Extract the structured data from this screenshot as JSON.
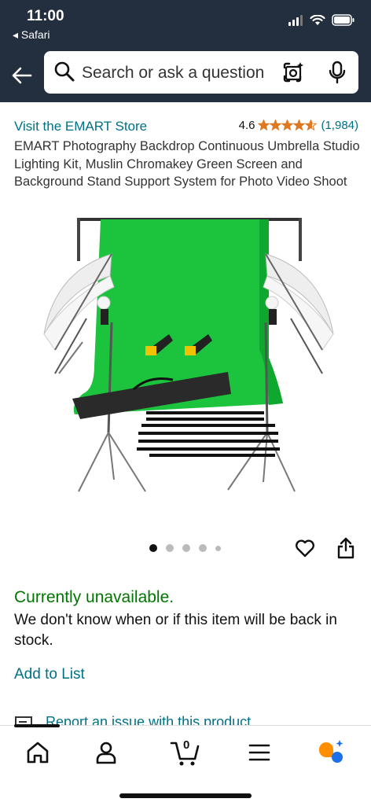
{
  "status_bar": {
    "time": "11:00",
    "back_app": "◂ Safari"
  },
  "search": {
    "placeholder": "Search or ask a question"
  },
  "product": {
    "store_link": "Visit the EMART Store",
    "rating": "4.6",
    "stars": 4.6,
    "review_count": "(1,984)",
    "title": "EMART Photography Backdrop Continuous Umbrella Studio Lighting Kit, Muslin Chromakey Green Screen and Background Stand Support System for Photo Video Shoot",
    "image_pages": 5,
    "image_current": 1
  },
  "availability": {
    "status": "Currently unavailable.",
    "message": "We don't know when or if this item will be back in stock."
  },
  "actions": {
    "add_to_list": "Add to List",
    "report_issue": "Report an issue with this product"
  },
  "cart": {
    "count": "0"
  },
  "colors": {
    "header_bg": "#232f3e",
    "link": "#007185",
    "available_green": "#007600",
    "star": "#de7921",
    "backdrop_green": "#1bc43c"
  },
  "icons": [
    "back-arrow-icon",
    "search-icon",
    "camera-lens-icon",
    "microphone-icon",
    "heart-icon",
    "share-icon",
    "home-icon",
    "account-icon",
    "cart-icon",
    "menu-icon",
    "rufus-icon"
  ]
}
